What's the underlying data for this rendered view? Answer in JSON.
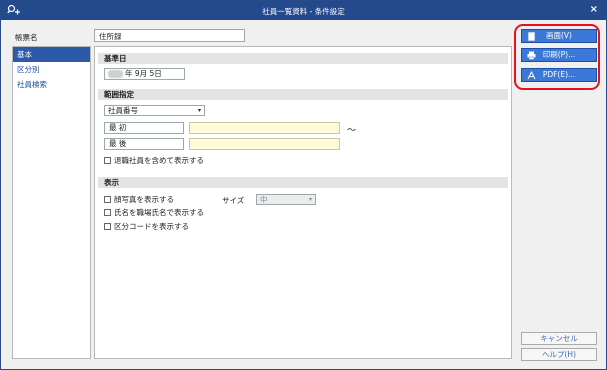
{
  "window": {
    "title": "社員一覧資料 - 条件設定",
    "close_label": "×"
  },
  "form": {
    "label": "帳票名",
    "value": "住所録"
  },
  "sidebar": {
    "items": [
      {
        "label": "基本",
        "active": true
      },
      {
        "label": "区分別",
        "active": false
      },
      {
        "label": "社員検索",
        "active": false
      }
    ]
  },
  "base_date": {
    "heading": "基準日",
    "value": "年  9月  5日"
  },
  "range": {
    "heading": "範囲指定",
    "select_value": "社員番号",
    "first_label": "最 初",
    "last_label": "最 後",
    "tilde": "〜",
    "include_retired": "退職社員を含めて表示する"
  },
  "display": {
    "heading": "表示",
    "show_photo": "顔写真を表示する",
    "size_label": "サイズ",
    "size_value": "中",
    "name_by_title": "氏名を職場氏名で表示する",
    "show_category_code": "区分コードを表示する"
  },
  "actions": {
    "screen": "画面(V)",
    "print": "印刷(P)...",
    "pdf": "PDF(E)...",
    "cancel": "キャンセル",
    "help": "ヘルプ(H)"
  },
  "colors": {
    "titlebar": "#244a8e",
    "primary_button": "#3c78d8",
    "highlight": "#e0141e",
    "range_input": "#fffbd9"
  }
}
